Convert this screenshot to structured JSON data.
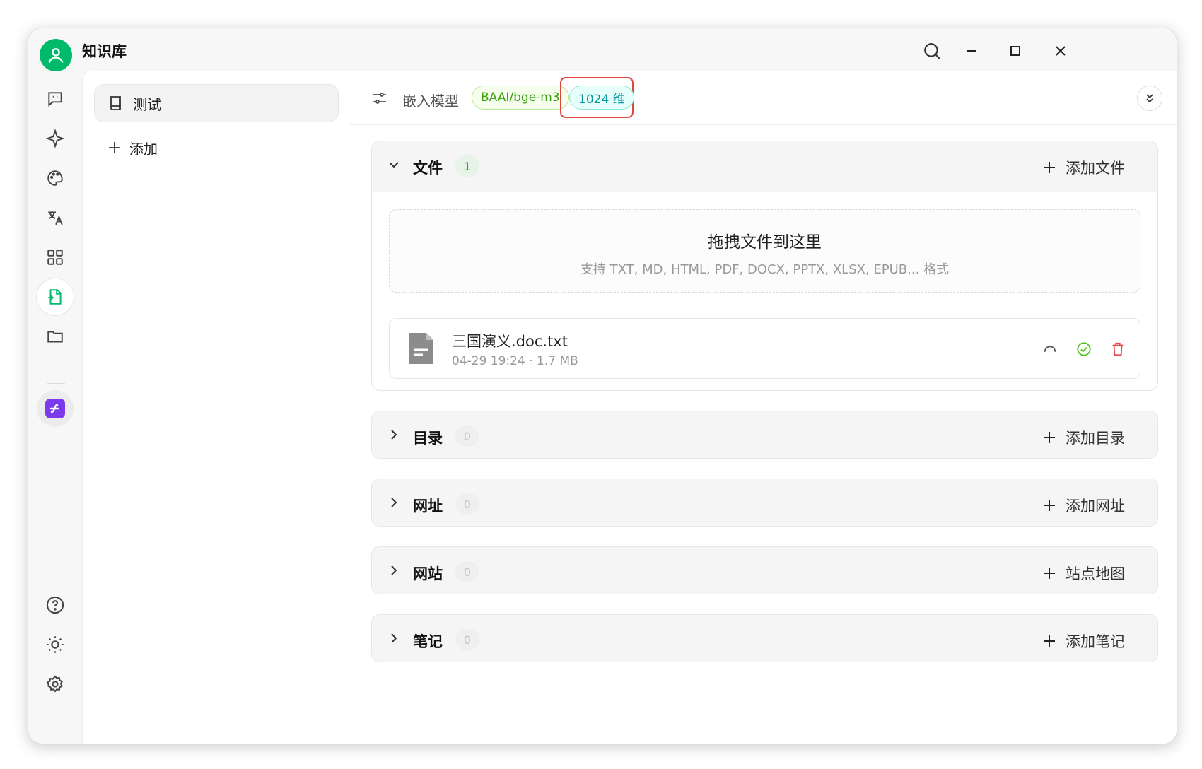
{
  "app": {
    "title": "知识库"
  },
  "knowledge_bases": {
    "items": [
      {
        "label": "测试"
      }
    ],
    "add_label": "添加"
  },
  "header": {
    "embed_label": "嵌入模型",
    "model_tag": "BAAI/bge-m3",
    "dimension_tag": "1024 维"
  },
  "sections": {
    "files": {
      "title": "文件",
      "count": "1",
      "action": "添加文件"
    },
    "directories": {
      "title": "目录",
      "count": "0",
      "action": "添加目录"
    },
    "urls": {
      "title": "网址",
      "count": "0",
      "action": "添加网址"
    },
    "sites": {
      "title": "网站",
      "count": "0",
      "action": "站点地图"
    },
    "notes": {
      "title": "笔记",
      "count": "0",
      "action": "添加笔记"
    }
  },
  "dropzone": {
    "title": "拖拽文件到这里",
    "subtitle": "支持 TXT, MD, HTML, PDF, DOCX, PPTX, XLSX, EPUB... 格式"
  },
  "files": [
    {
      "name": "三国演义.doc.txt",
      "meta": "04-29 19:24 · 1.7 MB"
    }
  ],
  "colors": {
    "brand_green": "#00b96b",
    "model_tag_text": "#389e0d",
    "dimension_tag_text": "#08979c",
    "highlight_frame": "#e0473a",
    "delete_red": "#e5484d",
    "ok_green": "#52c41a"
  }
}
